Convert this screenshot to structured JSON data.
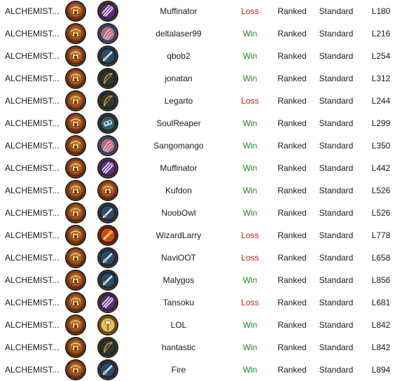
{
  "rows": [
    {
      "deck": "ALCHEMIST...",
      "hero_icon": "hero-portrait-icon",
      "opponent_icon": "claw-icon",
      "opponent": "Muffinator",
      "result": "Loss",
      "mode": "Ranked",
      "format": "Standard",
      "turns": "L180"
    },
    {
      "deck": "ALCHEMIST...",
      "hero_icon": "hero-portrait-icon",
      "opponent_icon": "tentacle-icon",
      "opponent": "deltalaser99",
      "result": "Win",
      "mode": "Ranked",
      "format": "Standard",
      "turns": "L216"
    },
    {
      "deck": "ALCHEMIST...",
      "hero_icon": "hero-portrait-icon",
      "opponent_icon": "sword-icon",
      "opponent": "qbob2",
      "result": "Win",
      "mode": "Ranked",
      "format": "Standard",
      "turns": "L254"
    },
    {
      "deck": "ALCHEMIST...",
      "hero_icon": "hero-portrait-icon",
      "opponent_icon": "bow-icon",
      "opponent": "jonatan",
      "result": "Win",
      "mode": "Ranked",
      "format": "Standard",
      "turns": "L312"
    },
    {
      "deck": "ALCHEMIST...",
      "hero_icon": "hero-portrait-icon",
      "opponent_icon": "bow-icon",
      "opponent": "Legarto",
      "result": "Loss",
      "mode": "Ranked",
      "format": "Standard",
      "turns": "L244"
    },
    {
      "deck": "ALCHEMIST...",
      "hero_icon": "hero-portrait-icon",
      "opponent_icon": "mech-icon",
      "opponent": "SoulReaper",
      "result": "Win",
      "mode": "Ranked",
      "format": "Standard",
      "turns": "L299"
    },
    {
      "deck": "ALCHEMIST...",
      "hero_icon": "hero-portrait-icon",
      "opponent_icon": "tentacle-icon",
      "opponent": "Sangomango",
      "result": "Win",
      "mode": "Ranked",
      "format": "Standard",
      "turns": "L350"
    },
    {
      "deck": "ALCHEMIST...",
      "hero_icon": "hero-portrait-icon",
      "opponent_icon": "claw-icon",
      "opponent": "Muffinator",
      "result": "Win",
      "mode": "Ranked",
      "format": "Standard",
      "turns": "L442"
    },
    {
      "deck": "ALCHEMIST...",
      "hero_icon": "hero-portrait-icon",
      "opponent_icon": "hero-portrait-icon",
      "opponent": "Kufdon",
      "result": "Win",
      "mode": "Ranked",
      "format": "Standard",
      "turns": "L526"
    },
    {
      "deck": "ALCHEMIST...",
      "hero_icon": "hero-portrait-icon",
      "opponent_icon": "sword-icon",
      "opponent": "NoobOwl",
      "result": "Win",
      "mode": "Ranked",
      "format": "Standard",
      "turns": "L526"
    },
    {
      "deck": "ALCHEMIST...",
      "hero_icon": "hero-portrait-icon",
      "opponent_icon": "fire-icon",
      "opponent": "WizardLarry",
      "result": "Loss",
      "mode": "Ranked",
      "format": "Standard",
      "turns": "L778"
    },
    {
      "deck": "ALCHEMIST...",
      "hero_icon": "hero-portrait-icon",
      "opponent_icon": "sword-icon",
      "opponent": "NaviOOT",
      "result": "Loss",
      "mode": "Ranked",
      "format": "Standard",
      "turns": "L658"
    },
    {
      "deck": "ALCHEMIST...",
      "hero_icon": "hero-portrait-icon",
      "opponent_icon": "sword-icon",
      "opponent": "Malygos",
      "result": "Win",
      "mode": "Ranked",
      "format": "Standard",
      "turns": "L856"
    },
    {
      "deck": "ALCHEMIST...",
      "hero_icon": "hero-portrait-icon",
      "opponent_icon": "claw-icon",
      "opponent": "Tansoku",
      "result": "Loss",
      "mode": "Ranked",
      "format": "Standard",
      "turns": "L681"
    },
    {
      "deck": "ALCHEMIST...",
      "hero_icon": "hero-portrait-icon",
      "opponent_icon": "hammer-icon",
      "opponent": "LOL",
      "result": "Win",
      "mode": "Ranked",
      "format": "Standard",
      "turns": "L842"
    },
    {
      "deck": "ALCHEMIST...",
      "hero_icon": "hero-portrait-icon",
      "opponent_icon": "bow-icon",
      "opponent": "hantastic",
      "result": "Win",
      "mode": "Ranked",
      "format": "Standard",
      "turns": "L842"
    },
    {
      "deck": "ALCHEMIST...",
      "hero_icon": "hero-portrait-icon",
      "opponent_icon": "sword-icon",
      "opponent": "Fire",
      "result": "Win",
      "mode": "Ranked",
      "format": "Standard",
      "turns": "L894"
    }
  ],
  "colors": {
    "win": "#1b8a1b",
    "loss": "#d11a1a",
    "text": "#1a1a1a"
  }
}
